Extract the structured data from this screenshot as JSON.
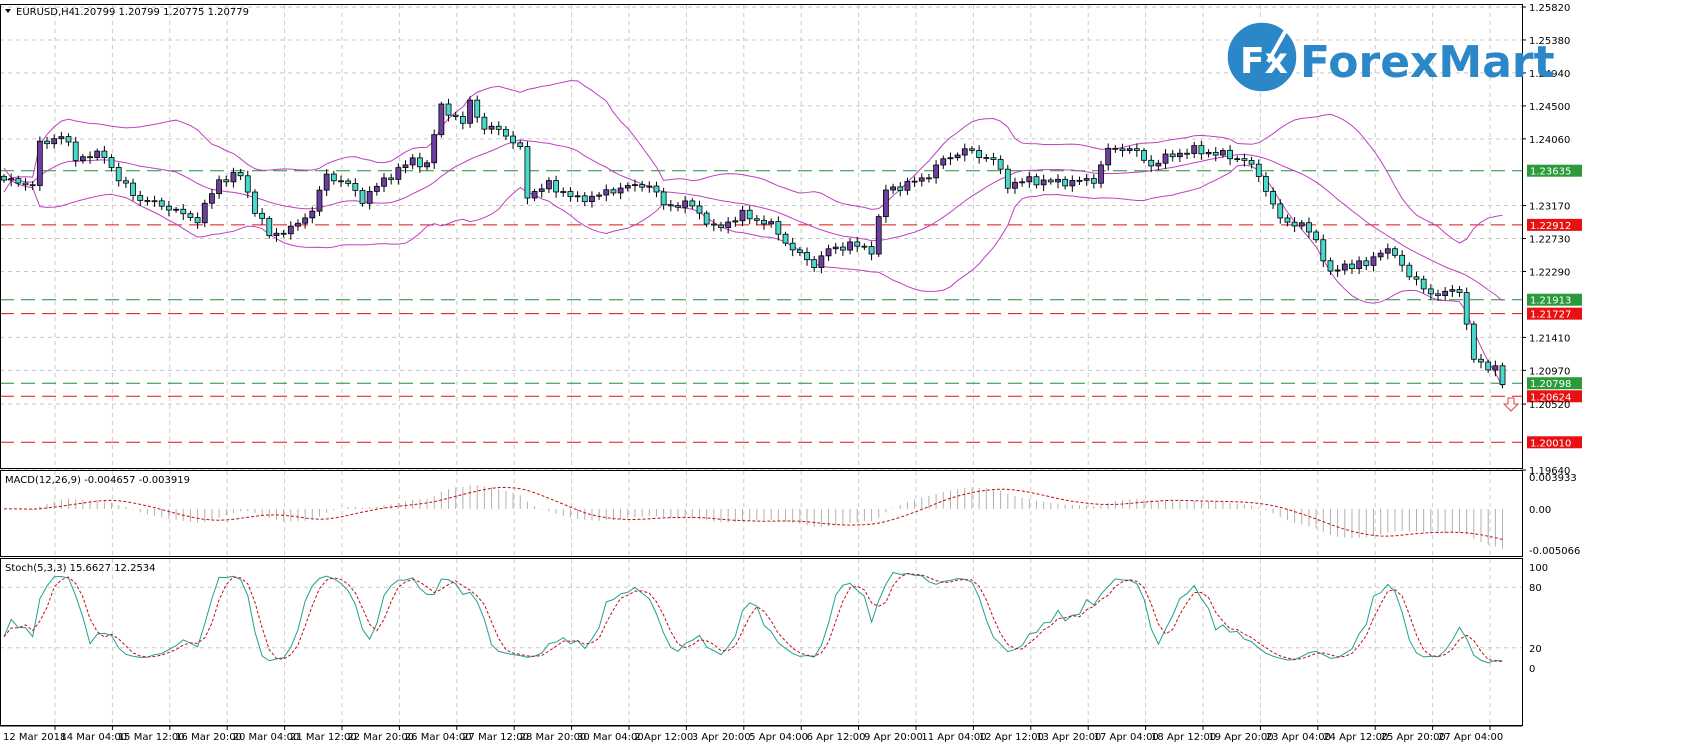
{
  "header": {
    "symbol": "EURUSD,H4",
    "ohlc": "1.20799 1.20799 1.20775 1.20779"
  },
  "logo": {
    "text": "ForexMart",
    "mark": "Fx",
    "color": "#2b87c8"
  },
  "colors": {
    "bull": "#6b3fa0",
    "bear": "#48d8cc",
    "bands": "#c040c0",
    "level_green": "#1f8f3a",
    "level_red": "#e01010",
    "macd_hist": "#b0b0b0",
    "macd_signal": "#c01010",
    "stoch_main": "#20a090",
    "stoch_signal": "#c01010",
    "grid": "#c8c8c8"
  },
  "chart_data": [
    {
      "type": "candlestick",
      "title": "EURUSD,H4",
      "ylim": [
        1.1964,
        1.2582
      ],
      "grid": true,
      "price_ticks": [
        "1.25820",
        "1.25380",
        "1.24940",
        "1.24500",
        "1.24060",
        "1.23170",
        "1.22730",
        "1.22290",
        "1.21410",
        "1.20970",
        "1.20520",
        "1.19640"
      ],
      "x_tick_labels": [
        "12 Mar 2018",
        "14 Mar 04:00",
        "15 Mar 12:00",
        "16 Mar 20:00",
        "20 Mar 04:00",
        "21 Mar 12:00",
        "22 Mar 20:00",
        "26 Mar 04:00",
        "27 Mar 12:00",
        "28 Mar 20:00",
        "30 Mar 04:00",
        "2 Apr 12:00",
        "3 Apr 20:00",
        "5 Apr 04:00",
        "6 Apr 12:00",
        "9 Apr 20:00",
        "11 Apr 04:00",
        "12 Apr 12:00",
        "13 Apr 20:00",
        "17 Apr 04:00",
        "18 Apr 12:00",
        "19 Apr 20:00",
        "23 Apr 04:00",
        "24 Apr 12:00",
        "25 Apr 20:00",
        "27 Apr 04:00"
      ],
      "bars_per_tick": 8,
      "bar_count": 210,
      "close_anchors": [
        [
          0,
          1.2351
        ],
        [
          4,
          1.2345
        ],
        [
          5,
          1.2398
        ],
        [
          8,
          1.2411
        ],
        [
          10,
          1.2381
        ],
        [
          14,
          1.2385
        ],
        [
          16,
          1.2351
        ],
        [
          19,
          1.2325
        ],
        [
          22,
          1.2318
        ],
        [
          25,
          1.2305
        ],
        [
          27,
          1.2298
        ],
        [
          30,
          1.2351
        ],
        [
          33,
          1.2358
        ],
        [
          35,
          1.2311
        ],
        [
          37,
          1.2278
        ],
        [
          40,
          1.2285
        ],
        [
          43,
          1.2311
        ],
        [
          45,
          1.2358
        ],
        [
          48,
          1.2345
        ],
        [
          50,
          1.2325
        ],
        [
          53,
          1.2351
        ],
        [
          57,
          1.2378
        ],
        [
          59,
          1.2371
        ],
        [
          61,
          1.2451
        ],
        [
          64,
          1.2425
        ],
        [
          65,
          1.2458
        ],
        [
          67,
          1.2418
        ],
        [
          69,
          1.2421
        ],
        [
          72,
          1.2391
        ],
        [
          73,
          1.2331
        ],
        [
          76,
          1.2345
        ],
        [
          80,
          1.2325
        ],
        [
          83,
          1.2331
        ],
        [
          86,
          1.2341
        ],
        [
          90,
          1.2345
        ],
        [
          92,
          1.2318
        ],
        [
          96,
          1.2318
        ],
        [
          99,
          1.2285
        ],
        [
          103,
          1.2305
        ],
        [
          107,
          1.2291
        ],
        [
          110,
          1.2258
        ],
        [
          113,
          1.2238
        ],
        [
          115,
          1.2258
        ],
        [
          118,
          1.2265
        ],
        [
          121,
          1.2258
        ],
        [
          123,
          1.2338
        ],
        [
          126,
          1.2345
        ],
        [
          129,
          1.2358
        ],
        [
          131,
          1.2378
        ],
        [
          134,
          1.2391
        ],
        [
          138,
          1.2378
        ],
        [
          140,
          1.2345
        ],
        [
          143,
          1.2351
        ],
        [
          147,
          1.2348
        ],
        [
          152,
          1.2351
        ],
        [
          154,
          1.2391
        ],
        [
          157,
          1.2394
        ],
        [
          160,
          1.2371
        ],
        [
          163,
          1.2385
        ],
        [
          166,
          1.2391
        ],
        [
          170,
          1.2385
        ],
        [
          173,
          1.2378
        ],
        [
          175,
          1.2358
        ],
        [
          178,
          1.2298
        ],
        [
          181,
          1.2291
        ],
        [
          183,
          1.2271
        ],
        [
          185,
          1.2225
        ],
        [
          187,
          1.2238
        ],
        [
          190,
          1.2238
        ],
        [
          192,
          1.2258
        ],
        [
          194,
          1.2251
        ],
        [
          196,
          1.2225
        ],
        [
          198,
          1.2205
        ],
        [
          200,
          1.2198
        ],
        [
          203,
          1.2205
        ],
        [
          205,
          1.2111
        ],
        [
          206,
          1.2105
        ],
        [
          208,
          1.2101
        ],
        [
          209,
          1.2078
        ]
      ],
      "indicator": "Bollinger Bands (20, 2)",
      "levels": [
        {
          "value": "1.23635",
          "color": "green"
        },
        {
          "value": "1.22912",
          "color": "red"
        },
        {
          "value": "1.21913",
          "color": "green"
        },
        {
          "value": "1.21727",
          "color": "red"
        },
        {
          "value": "1.20798",
          "color": "green"
        },
        {
          "value": "1.20624",
          "color": "red"
        },
        {
          "value": "1.20010",
          "color": "red"
        }
      ],
      "signal_arrow": "down-arrow"
    },
    {
      "type": "bar+line",
      "label": "MACD(12,26,9) -0.004657 -0.003919",
      "ylim": [
        -0.005066,
        0.003933
      ],
      "ticks": [
        "0.003933",
        "0.00",
        "-0.005066"
      ]
    },
    {
      "type": "line",
      "label": "Stoch(5,3,3) 15.6627 12.2534",
      "ylim": [
        0,
        100
      ],
      "ticks": [
        "100",
        "80",
        "20",
        "0"
      ]
    }
  ]
}
